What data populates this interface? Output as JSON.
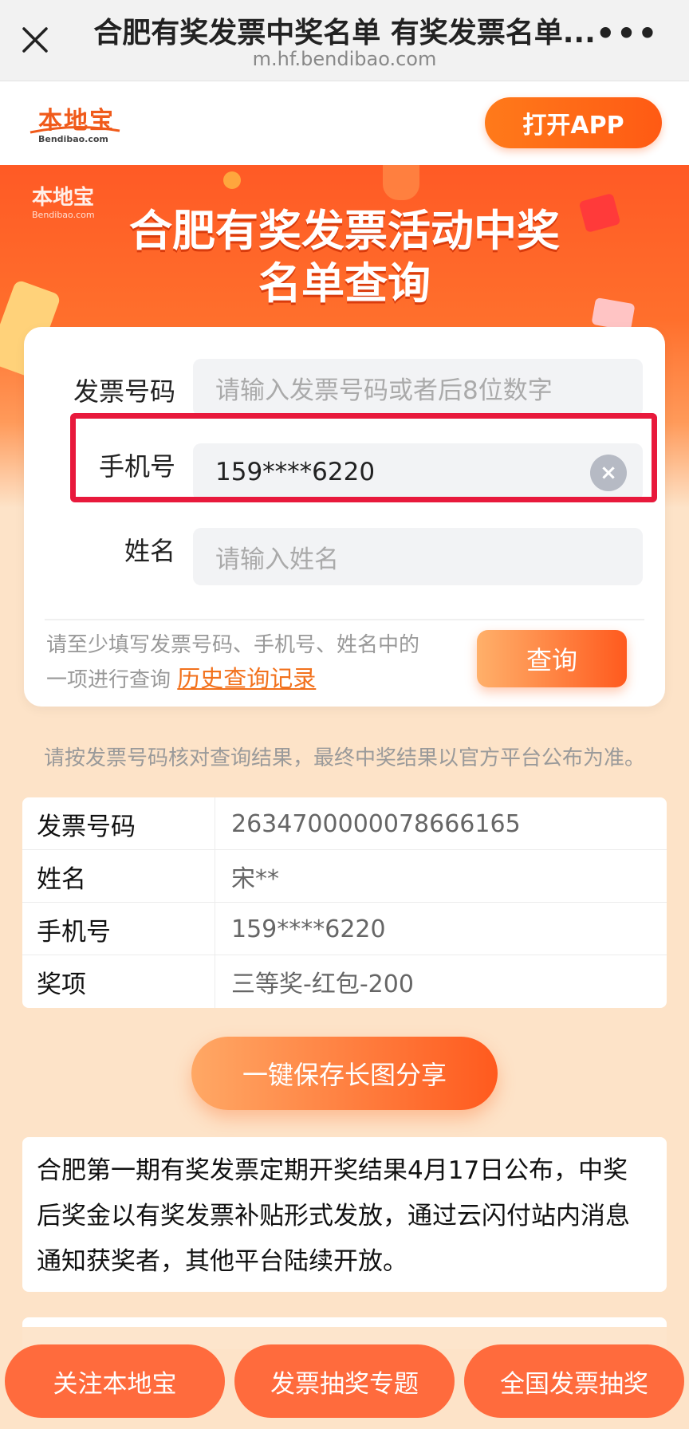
{
  "browser": {
    "title": "合肥有奖发票中奖名单 有奖发票名单...",
    "url": "m.hf.bendibao.com",
    "more_label": "•••"
  },
  "header": {
    "logo_cn": "本地宝",
    "logo_en": "Bendibao.com",
    "open_app_label": "打开APP"
  },
  "hero": {
    "logo_cn": "本地宝",
    "logo_en": "Bendibao.com",
    "title_line1": "合肥有奖发票活动中奖",
    "title_line2": "名单查询"
  },
  "form": {
    "invoice_label": "发票号码",
    "invoice_placeholder": "请输入发票号码或者后8位数字",
    "phone_label": "手机号",
    "phone_value": "159****6220",
    "name_label": "姓名",
    "name_placeholder": "请输入姓名",
    "hint_line1": "请至少填写发票号码、手机号、姓名中的",
    "hint_line2": "一项进行查询",
    "history_link": "历史查询记录",
    "query_button": "查询",
    "clear_symbol": "×"
  },
  "notice": "请按发票号码核对查询结果，最终中奖结果以官方平台公布为准。",
  "result": {
    "rows": [
      {
        "label": "发票号码",
        "value": "2634700000078666165"
      },
      {
        "label": "姓名",
        "value": "宋**"
      },
      {
        "label": "手机号",
        "value": "159****6220"
      },
      {
        "label": "奖项",
        "value": "三等奖-红包-200"
      }
    ]
  },
  "save_button": "一键保存长图分享",
  "announcement": {
    "line1": "合肥第一期有奖发票定期开奖结果4月17日公布，中奖",
    "line2": "后奖金以有奖发票补贴形式发放，通过云闪付站内消息",
    "line3": "通知获奖者，其他平台陆续开放。"
  },
  "bottom_bar": {
    "follow": "关注本地宝",
    "topic": "发票抽奖专题",
    "national": "全国发票抽奖"
  },
  "colors": {
    "accent": "#ff5a1e",
    "highlight_border": "#e8193c",
    "page_bg": "#fde3c8",
    "link": "#f2711c"
  }
}
